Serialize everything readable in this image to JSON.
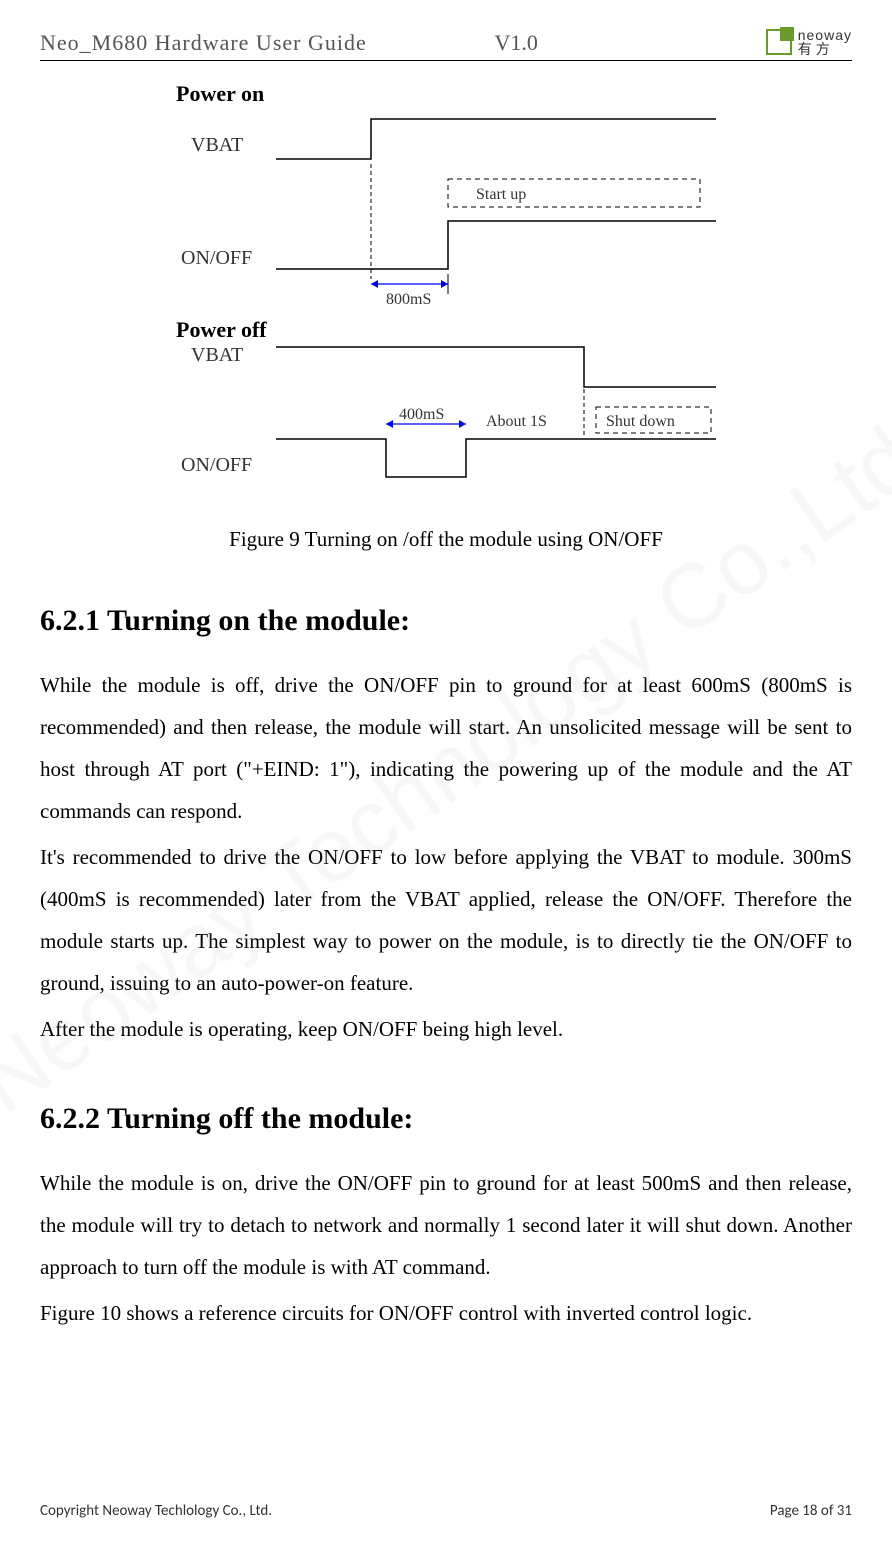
{
  "header": {
    "title": "Neo_M680 Hardware User Guide",
    "version": "V1.0",
    "logo_en": "neoway",
    "logo_cn": "有方"
  },
  "watermark": "Neoway Technology Co.,Ltd",
  "diagram": {
    "power_on_title": "Power on",
    "power_off_title": "Power off",
    "vbat": "VBAT",
    "onoff": "ON/OFF",
    "start_up": "Start up",
    "t800": "800mS",
    "t400": "400mS",
    "about1s": "About 1S",
    "shutdown": "Shut down"
  },
  "caption": "Figure 9 Turning on /off the module using ON/OFF",
  "s621": {
    "heading": "6.2.1  Turning on the module:",
    "p1": "While the module is off, drive the ON/OFF pin to ground for at least 600mS (800mS is recommended) and then release, the module will start. An unsolicited message will be sent to host through AT port (\"+EIND: 1\"), indicating the powering up of the module and the AT commands can respond.",
    "p2": "It's recommended to drive the ON/OFF to low before applying the VBAT to module. 300mS (400mS is recommended) later from the VBAT applied, release the ON/OFF. Therefore the module starts up. The simplest way to power on the module, is to directly tie the ON/OFF to ground, issuing to an auto-power-on feature.",
    "p3": "After the module is operating, keep ON/OFF being high level."
  },
  "s622": {
    "heading": "6.2.2  Turning off the module:",
    "p1": "While the module is on, drive the ON/OFF pin to ground for at least 500mS and then release, the module will try to detach to network and normally 1 second later it will shut down. Another approach to turn off the module is with AT command.",
    "p2": "Figure 10 shows a reference circuits for ON/OFF control with inverted control logic."
  },
  "footer": {
    "left": "Copyright Neoway Techlology Co., Ltd.",
    "right": "Page 18 of 31"
  }
}
